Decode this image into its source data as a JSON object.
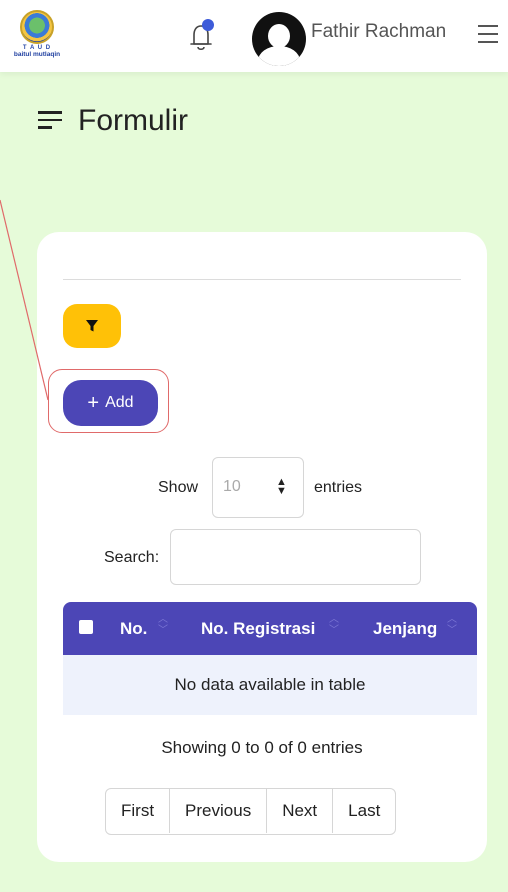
{
  "header": {
    "logo_top_text": "T A U D",
    "logo_name": "baitul mutlaqin",
    "user_name": "Fathir Rachman",
    "icons": [
      "bell-icon",
      "avatar",
      "hamburger-menu-icon"
    ],
    "notification_color": "#3d5bd9"
  },
  "page": {
    "title": "Formulir"
  },
  "card": {
    "add_label": "Add",
    "show_label": "Show",
    "entries_value": "10",
    "entries_label": "entries",
    "search_label": "Search:",
    "search_value": "",
    "table": {
      "columns": [
        "No.",
        "No. Registrasi",
        "Jenjang"
      ],
      "empty_message": "No data available in table"
    },
    "info": "Showing 0 to 0 of 0 entries",
    "pagination": [
      "First",
      "Previous",
      "Next",
      "Last"
    ]
  },
  "colors": {
    "background": "#e6fbd9",
    "primary": "#4c46b6",
    "filter": "#ffc107",
    "highlight": "#e06a6a"
  }
}
